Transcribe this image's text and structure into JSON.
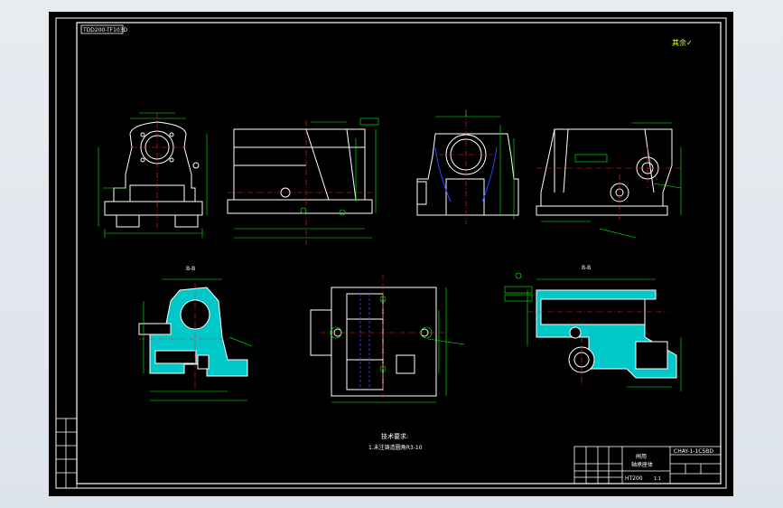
{
  "drawing": {
    "code_tag": "TDD200-TF103D",
    "roughness_note": "其余✓",
    "tech_req_title": "技术要求:",
    "tech_req_line": "1.未注铸造圆角R3-10",
    "title_block": {
      "part_name_1": "闸用",
      "part_name_2": "轴承座体",
      "drawing_no": "CHAY-1-1C5BD",
      "material": "HT200",
      "scale": "1:1"
    },
    "left_table_rows": [
      "",
      "",
      "",
      "",
      ""
    ],
    "section_label_left": "B-B",
    "section_label_right": "B-B",
    "colors": {
      "outline": "#ffffff",
      "dimension": "#00ff00",
      "centerline": "#ff2020",
      "hatch": "#00d0d0",
      "hidden": "#3040ff",
      "symbol": "#ffff00"
    }
  }
}
